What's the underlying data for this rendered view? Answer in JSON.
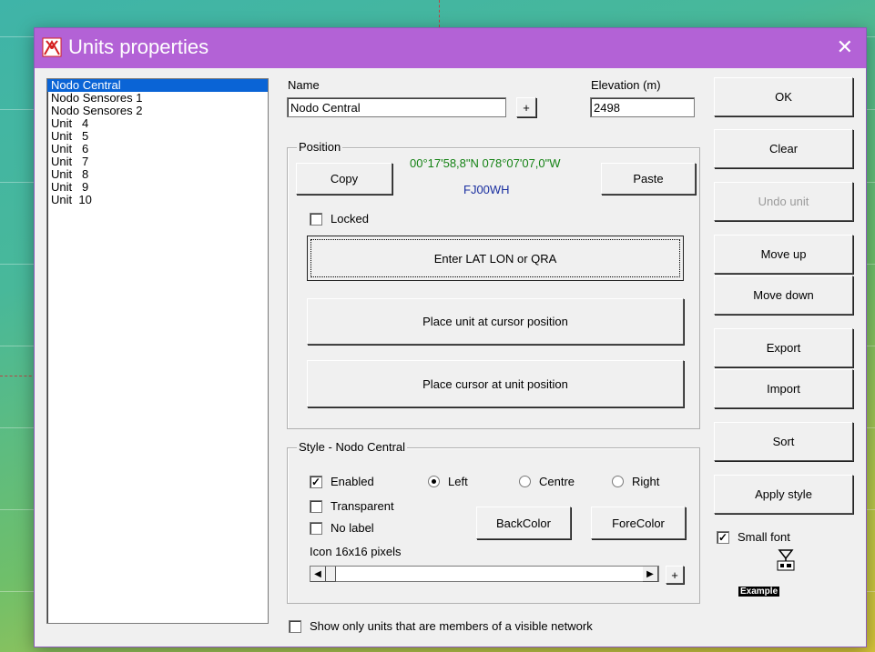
{
  "window": {
    "title": "Units properties",
    "close_glyph": "✕",
    "title_color": "#b362d6"
  },
  "units": [
    "Nodo Central",
    "Nodo Sensores 1",
    "Nodo Sensores 2",
    "Unit   4",
    "Unit   5",
    "Unit   6",
    "Unit   7",
    "Unit   8",
    "Unit   9",
    "Unit  10"
  ],
  "selected_unit": "Nodo Central",
  "name": {
    "label": "Name",
    "value": "Nodo Central",
    "plus": "+"
  },
  "elevation": {
    "label": "Elevation (m)",
    "value": "2498"
  },
  "position": {
    "title": "Position",
    "coords": "00°17'58,8\"N 078°07'07,0\"W",
    "coords_color": "#148214",
    "qra": "FJ00WH",
    "qra_color": "#1a2fa0",
    "copy": "Copy",
    "paste": "Paste",
    "locked": "Locked",
    "enter_latlon": "Enter LAT LON or QRA",
    "place_unit": "Place unit at cursor position",
    "place_cursor": "Place cursor at unit position"
  },
  "style": {
    "title": "Style - Nodo Central",
    "enabled": "Enabled",
    "transparent": "Transparent",
    "no_label": "No label",
    "left": "Left",
    "centre": "Centre",
    "right": "Right",
    "backcolor": "BackColor",
    "forecolor": "ForeColor",
    "icon_size": "Icon 16x16 pixels",
    "plus": "+",
    "slider_level": 0
  },
  "right_buttons": {
    "ok": "OK",
    "clear": "Clear",
    "undo_unit": "Undo unit",
    "move_up": "Move up",
    "move_down": "Move down",
    "export": "Export",
    "import": "Import",
    "sort": "Sort",
    "apply_style": "Apply style",
    "small_font": "Small font",
    "example": "Example"
  },
  "show_only": "Show only units that are members of a visible network"
}
